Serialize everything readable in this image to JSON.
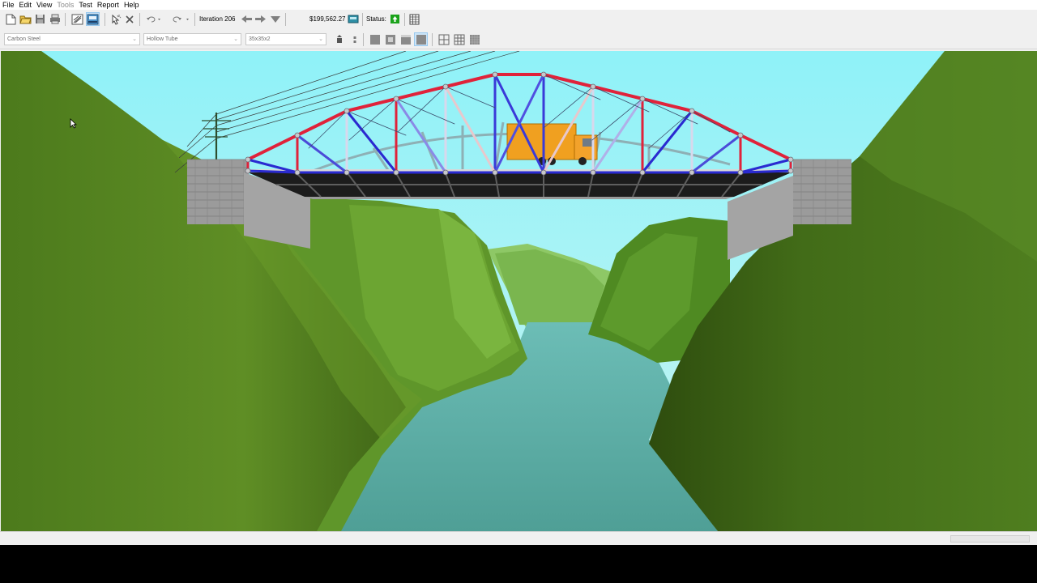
{
  "menu": {
    "items": [
      {
        "label": "File",
        "enabled": true
      },
      {
        "label": "Edit",
        "enabled": true
      },
      {
        "label": "View",
        "enabled": true
      },
      {
        "label": "Tools",
        "enabled": false
      },
      {
        "label": "Test",
        "enabled": true
      },
      {
        "label": "Report",
        "enabled": true
      },
      {
        "label": "Help",
        "enabled": true
      }
    ]
  },
  "toolbar": {
    "iteration_label": "Iteration 206",
    "cost": "$199,562.27",
    "status_label": "Status:",
    "status_color": "#1aa21a",
    "icons": [
      "new-document-icon",
      "open-folder-icon",
      "save-icon",
      "print-icon",
      "design-mode-icon",
      "load-test-mode-icon",
      "select-icon",
      "delete-icon",
      "undo-icon",
      "redo-icon",
      "previous-iteration-icon",
      "next-iteration-icon",
      "iteration-list-icon",
      "cost-calculator-icon",
      "status-icon",
      "member-table-icon"
    ]
  },
  "properties": {
    "material": "Carbon Steel",
    "section": "Hollow Tube",
    "size": "35x35x2"
  },
  "colors": {
    "sky": "#8ff2f7",
    "compression_member": "#e0223a",
    "tension_member": "#2a2ad0",
    "hill_dark": "#3e5e16",
    "hill_light": "#6f9e2c",
    "water": "#5aa8a0",
    "truck": "#f0a020"
  }
}
